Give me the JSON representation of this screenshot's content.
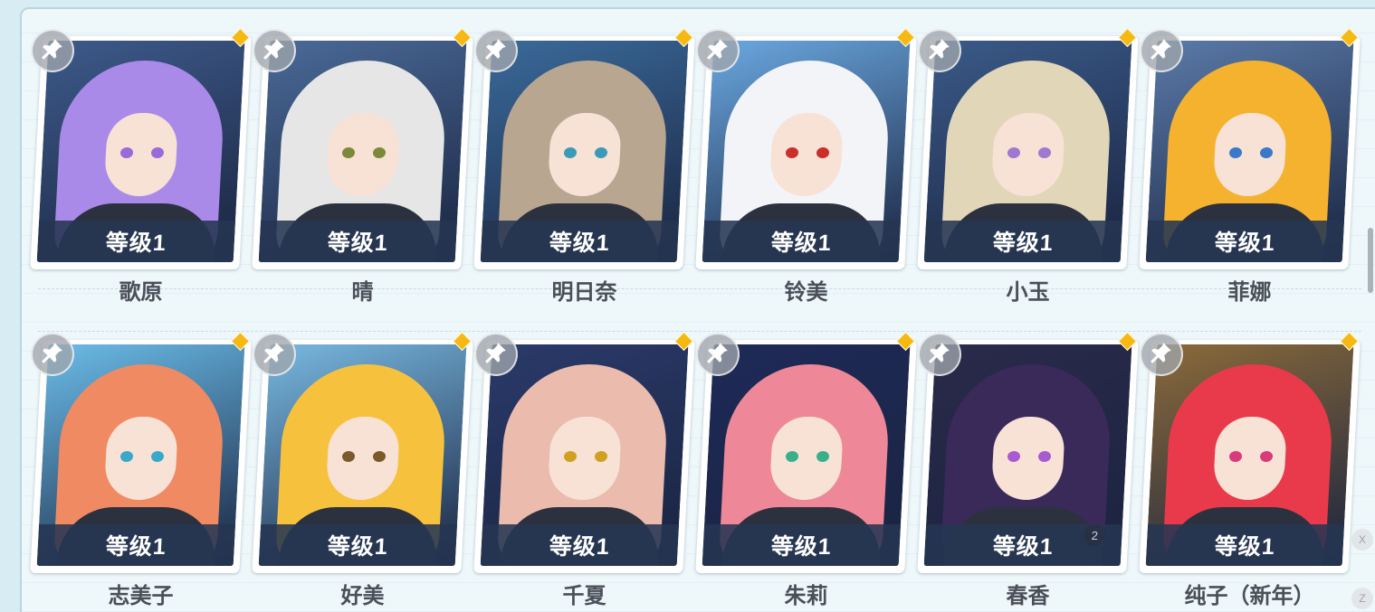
{
  "level_prefix": "等级",
  "characters": [
    {
      "name": "歌原",
      "level": "等级1",
      "hair": "#a98ae8",
      "bg": "#3d5a8a",
      "eye": "#9a6ad8",
      "underline": false
    },
    {
      "name": "晴",
      "level": "等级1",
      "hair": "#e6e6e6",
      "bg": "#4a6a98",
      "eye": "#7a8a3a",
      "underline": false
    },
    {
      "name": "明日奈",
      "level": "等级1",
      "hair": "#b8a690",
      "bg": "#3a6a9a",
      "eye": "#3a9ab8",
      "underline": false
    },
    {
      "name": "铃美",
      "level": "等级1",
      "hair": "#f2f4f8",
      "bg": "#6aa8e0",
      "eye": "#c8302a",
      "underline": false
    },
    {
      "name": "小玉",
      "level": "等级1",
      "hair": "#e2d6b8",
      "bg": "#3a5a88",
      "eye": "#a078d0",
      "underline": false
    },
    {
      "name": "菲娜",
      "level": "等级1",
      "hair": "#f4b22e",
      "bg": "#5a7aa8",
      "eye": "#3a78c8",
      "underline": true
    },
    {
      "name": "志美子",
      "level": "等级1",
      "hair": "#f08a62",
      "bg": "#6abce8",
      "eye": "#3aa8c8",
      "underline": true
    },
    {
      "name": "好美",
      "level": "等级1",
      "hair": "#f6c23e",
      "bg": "#78b8e0",
      "eye": "#7a5a2a",
      "underline": false
    },
    {
      "name": "千夏",
      "level": "等级1",
      "hair": "#ebbcae",
      "bg": "#2a3a6a",
      "eye": "#d0a020",
      "underline": true
    },
    {
      "name": "朱莉",
      "level": "等级1",
      "hair": "#ee8898",
      "bg": "#1e2a58",
      "eye": "#3ab08a",
      "underline": false
    },
    {
      "name": "春香",
      "level": "等级1",
      "hair": "#3a2a5a",
      "bg": "#2a2a4a",
      "eye": "#a85ad0",
      "underline": true,
      "badge": "2"
    },
    {
      "name": "纯子（新年）",
      "level": "等级1",
      "hair": "#e83a4a",
      "bg": "#8a6a3a",
      "eye": "#d83a7a",
      "underline": true
    }
  ],
  "side_buttons": {
    "x_label": "X",
    "z_label": "Z"
  },
  "colors": {
    "level_band": "#253552",
    "pin_button": "#a0a5ac",
    "corner_dot": "#f6b912",
    "name_text": "#4a4f58"
  }
}
